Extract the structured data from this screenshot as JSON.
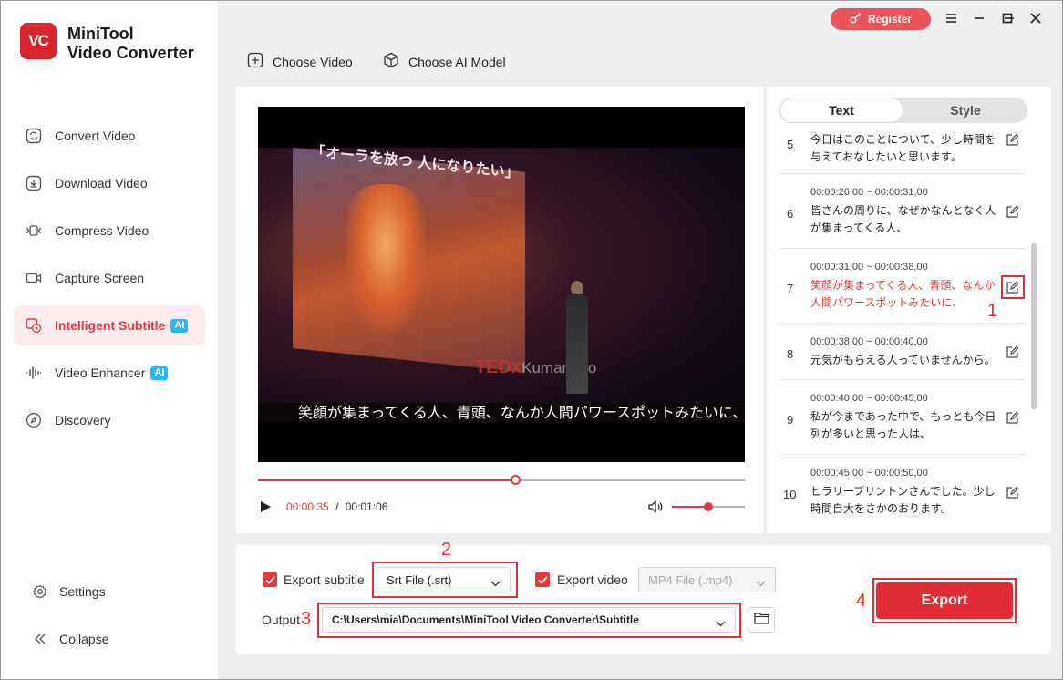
{
  "app": {
    "logo_text": "VC",
    "title_line1": "MiniTool",
    "title_line2": "Video Converter"
  },
  "sidebar": {
    "items": [
      {
        "label": "Convert Video",
        "icon": "convert-icon"
      },
      {
        "label": "Download Video",
        "icon": "download-icon"
      },
      {
        "label": "Compress Video",
        "icon": "compress-icon"
      },
      {
        "label": "Capture Screen",
        "icon": "camera-icon"
      },
      {
        "label": "Intelligent Subtitle",
        "icon": "subtitle-icon",
        "badge": "AI",
        "active": true
      },
      {
        "label": "Video Enhancer",
        "icon": "enhancer-icon",
        "badge": "AI"
      },
      {
        "label": "Discovery",
        "icon": "compass-icon"
      }
    ],
    "settings_label": "Settings",
    "collapse_label": "Collapse"
  },
  "header": {
    "register_label": "Register",
    "choose_video_label": "Choose Video",
    "choose_ai_model_label": "Choose AI Model"
  },
  "player": {
    "screen_text": "「オーラを放つ 人になりたい」",
    "stage_brand": "TEDx",
    "stage_brand_suffix": "Kumamoto",
    "subtitle_overlay": "笑顔が集まってくる人、青頭、なんか人間パワースポットみたいに、",
    "current_time": "00:00:35",
    "separator": "/",
    "total_time": "00:01:06",
    "progress": 0.53,
    "volume": 0.5
  },
  "subtitle_panel": {
    "tabs": [
      "Text",
      "Style"
    ],
    "active_tab": "Text",
    "rows": [
      {
        "num": "5",
        "time": "",
        "text": "今日はこのことについて、少し時間を与えておなしたいと思います。"
      },
      {
        "num": "6",
        "time": "00:00:26,00 ~ 00:00:31,00",
        "text": "皆さんの周りに、なぜかなんとなく人が集まってくる人、"
      },
      {
        "num": "7",
        "time": "00:00:31,00 ~ 00:00:38,00",
        "text": "笑顔が集まってくる人、青頭、なんか人間パワースポットみたいに、",
        "highlighted": true
      },
      {
        "num": "8",
        "time": "00:00:38,00 ~ 00:00:40,00",
        "text": "元気がもらえる人っていませんから。"
      },
      {
        "num": "9",
        "time": "00:00:40,00 ~ 00:00:45,00",
        "text": "私が今まであった中で、もっとも今日列が多いと思った人は、"
      },
      {
        "num": "10",
        "time": "00:00:45,00 ~ 00:00:50,00",
        "text": "ヒラリーブリントンさんでした。少し時間自大をさかのおります。"
      }
    ]
  },
  "export": {
    "export_subtitle_label": "Export subtitle",
    "subtitle_format": "Srt File (.srt)",
    "export_video_label": "Export video",
    "video_format": "MP4 File (.mp4)",
    "output_label": "Output",
    "output_path": "C:\\Users\\mia\\Documents\\MiniTool Video Converter\\Subtitle",
    "export_button": "Export"
  },
  "annotations": [
    "1",
    "2",
    "3",
    "4"
  ],
  "colors": {
    "accent": "#e03a3f",
    "annotation": "#e0303a",
    "ai_badge": "#2db7f0",
    "active_nav_bg": "#fdeced"
  }
}
